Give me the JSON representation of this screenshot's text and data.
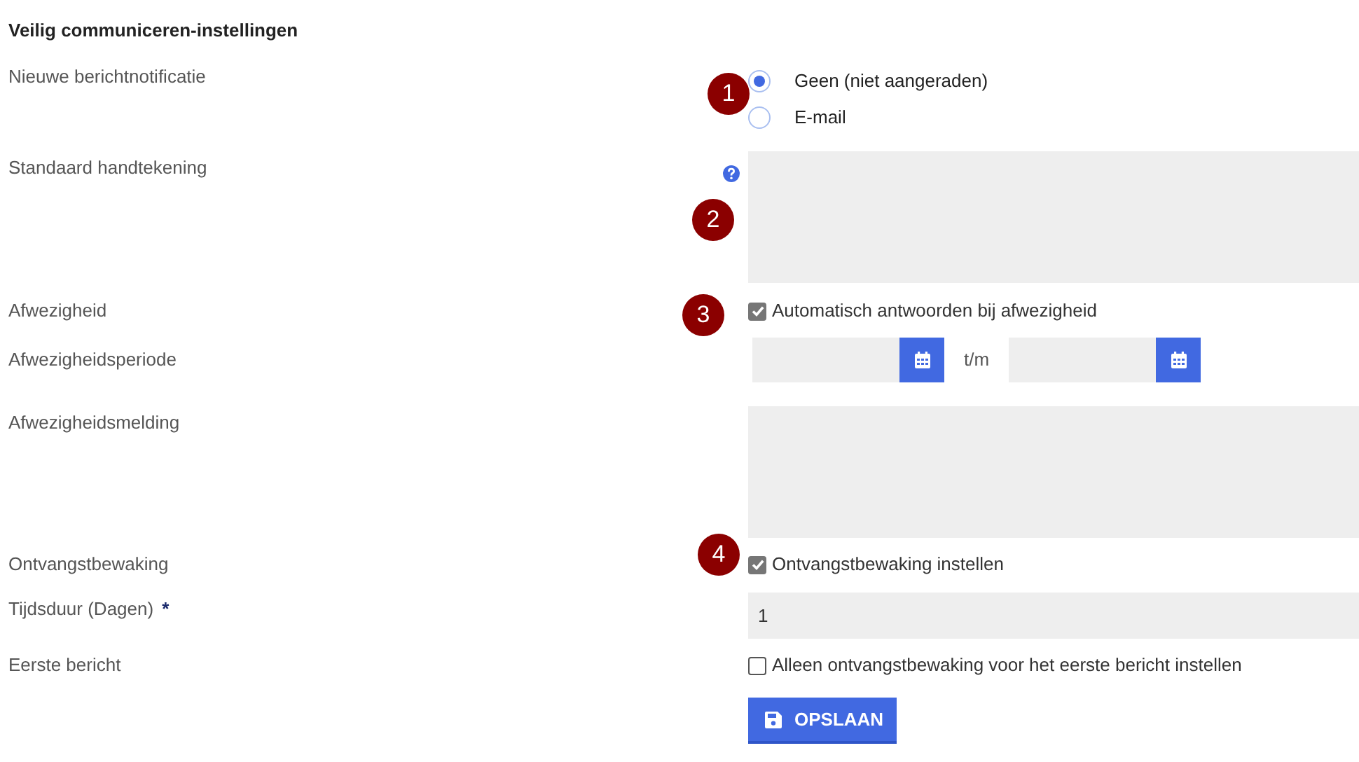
{
  "title": "Veilig communiceren-instellingen",
  "rows": [
    {
      "kind": "radio_group",
      "label": "Nieuwe berichtnotificatie",
      "options": [
        {
          "label": "Geen (niet aangeraden)",
          "selected": true
        },
        {
          "label": "E-mail",
          "selected": false
        }
      ]
    },
    {
      "kind": "textarea",
      "label": "Standaard handtekening",
      "help": true
    },
    {
      "kind": "checkbox",
      "label": "Afwezigheid",
      "text": "Automatisch antwoorden bij afwezigheid",
      "checked": true
    },
    {
      "kind": "date_range",
      "label": "Afwezigheidsperiode",
      "separator": "t/m"
    },
    {
      "kind": "textarea",
      "label": "Afwezigheidsmelding",
      "help": false
    },
    {
      "kind": "checkbox",
      "label": "Ontvangstbewaking",
      "text": "Ontvangstbewaking instellen",
      "checked": true
    },
    {
      "kind": "text_input",
      "label": "Tijdsduur (Dagen)",
      "required_mark": "*",
      "value": "1"
    },
    {
      "kind": "checkbox",
      "label": "Eerste bericht",
      "text": "Alleen ontvangstbewaking voor het eerste bericht instellen",
      "checked": false
    }
  ],
  "save_button": {
    "label": "OPSLAAN"
  },
  "callouts": [
    {
      "number": "1"
    },
    {
      "number": "2"
    },
    {
      "number": "3"
    },
    {
      "number": "4"
    }
  ]
}
